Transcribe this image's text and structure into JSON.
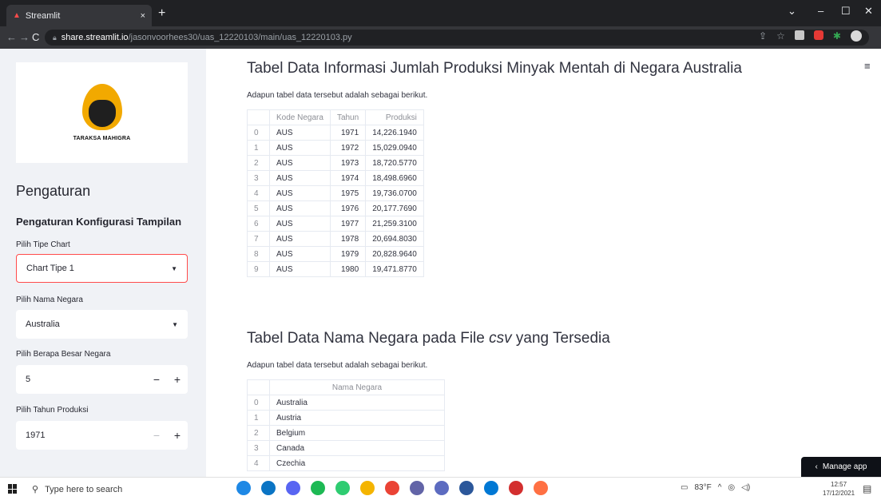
{
  "browser": {
    "tab_title": "Streamlit",
    "tab_close": "×",
    "new_tab": "+",
    "url_host": "share.streamlit.io",
    "url_path": "/jasonvoorhees30/uas_12220103/main/uas_12220103.py",
    "back": "←",
    "forward": "→",
    "reload": "C",
    "share_icon": "⇪",
    "star_icon": "☆",
    "minimize": "–",
    "maximize": "☐",
    "close": "✕",
    "dropdown": "⌄"
  },
  "sidebar": {
    "logo_text": "TARAKSA MAHIGRA",
    "heading": "Pengaturan",
    "subheading": "Pengaturan Konfigurasi Tampilan",
    "chart_type": {
      "label": "Pilih Tipe Chart",
      "value": "Chart Tipe 1"
    },
    "country": {
      "label": "Pilih Nama Negara",
      "value": "Australia"
    },
    "country_count": {
      "label": "Pilih Berapa Besar Negara",
      "value": "5",
      "minus": "−",
      "plus": "+"
    },
    "year": {
      "label": "Pilih Tahun Produksi",
      "value": "1971",
      "minus": "−",
      "plus": "+"
    }
  },
  "main": {
    "menu_icon": "≡",
    "section1": {
      "title": "Tabel Data Informasi Jumlah Produksi Minyak Mentah di Negara Australia",
      "desc": "Adapun tabel data tersebut adalah sebagai berikut.",
      "columns": [
        "",
        "Kode Negara",
        "Tahun",
        "Produksi"
      ],
      "rows": [
        [
          "0",
          "AUS",
          "1971",
          "14,226.1940"
        ],
        [
          "1",
          "AUS",
          "1972",
          "15,029.0940"
        ],
        [
          "2",
          "AUS",
          "1973",
          "18,720.5770"
        ],
        [
          "3",
          "AUS",
          "1974",
          "18,498.6960"
        ],
        [
          "4",
          "AUS",
          "1975",
          "19,736.0700"
        ],
        [
          "5",
          "AUS",
          "1976",
          "20,177.7690"
        ],
        [
          "6",
          "AUS",
          "1977",
          "21,259.3100"
        ],
        [
          "7",
          "AUS",
          "1978",
          "20,694.8030"
        ],
        [
          "8",
          "AUS",
          "1979",
          "20,828.9640"
        ],
        [
          "9",
          "AUS",
          "1980",
          "19,471.8770"
        ]
      ]
    },
    "section2": {
      "title_prefix": "Tabel Data Nama Negara pada File ",
      "title_em": "csv",
      "title_suffix": " yang Tersedia",
      "desc": "Adapun tabel data tersebut adalah sebagai berikut.",
      "columns": [
        "",
        "Nama Negara"
      ],
      "rows": [
        [
          "0",
          "Australia"
        ],
        [
          "1",
          "Austria"
        ],
        [
          "2",
          "Belgium"
        ],
        [
          "3",
          "Canada"
        ],
        [
          "4",
          "Czechia"
        ]
      ]
    },
    "manage_app": "Manage app",
    "manage_chevron": "‹"
  },
  "taskbar": {
    "search_placeholder": "Type here to search",
    "weather": "83°F",
    "time": "12:57",
    "date": "17/12/2021",
    "app_colors": [
      "#1e88e5",
      "#0a74c4",
      "#5865f2",
      "#1db954",
      "#2ecc71",
      "#f4b400",
      "#ea4335",
      "#6264a7",
      "#5c6bc0",
      "#2b579a",
      "#0078d4",
      "#d32f2f",
      "#ff7043"
    ]
  }
}
